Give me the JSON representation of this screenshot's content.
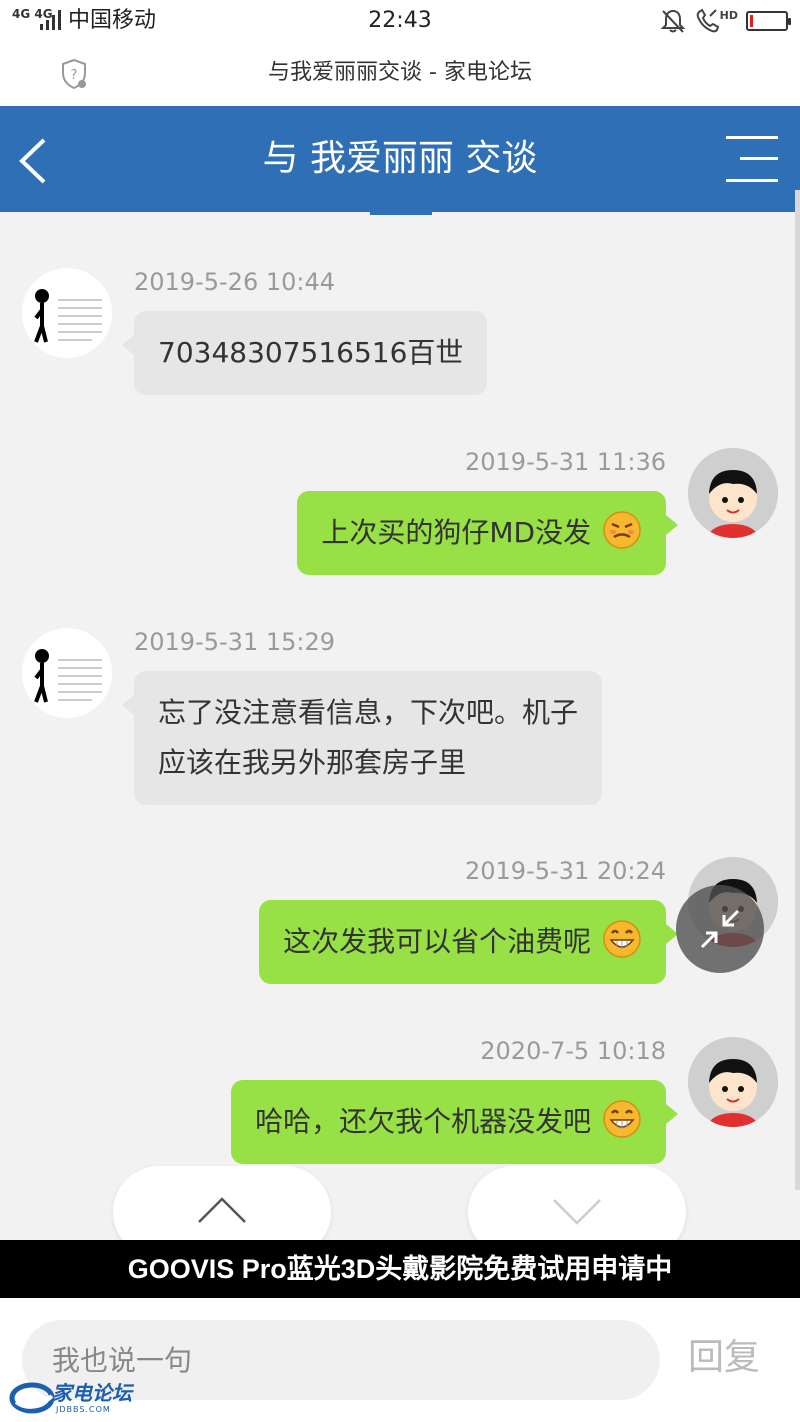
{
  "status_bar": {
    "network": "4G 4G",
    "carrier": "中国移动",
    "time": "22:43",
    "hd_label": "HD",
    "battery_level": 0.1,
    "battery_color": "#e02020",
    "icons": [
      "signal-icon",
      "mute-bell-icon",
      "hd-call-icon",
      "battery-icon"
    ]
  },
  "browser": {
    "title": "与我爱丽丽交谈 - 家电论坛",
    "icons": [
      "shield-question-icon"
    ]
  },
  "header": {
    "title": "与 我爱丽丽 交谈",
    "bg_color": "#2f6fb6",
    "icons": [
      "back-arrow-icon",
      "menu-icon"
    ]
  },
  "messages": [
    {
      "side": "left",
      "time": "2019-5-26 10:44",
      "lines": [
        "70348307516516百世"
      ],
      "emoji": ""
    },
    {
      "side": "right",
      "time": "2019-5-31 11:36",
      "lines": [
        "上次买的狗仔MD没发"
      ],
      "emoji": "annoyed-face-icon"
    },
    {
      "side": "left",
      "time": "2019-5-31 15:29",
      "lines": [
        "忘了没注意看信息，下次吧。机子",
        "应该在我另外那套房子里"
      ],
      "emoji": ""
    },
    {
      "side": "right",
      "time": "2019-5-31 20:24",
      "lines": [
        "这次发我可以省个油费呢"
      ],
      "emoji": "grin-face-icon"
    },
    {
      "side": "right",
      "time": "2020-7-5 10:18",
      "lines": [
        "哈哈，还欠我个机器没发吧"
      ],
      "emoji": "grin-face-icon"
    }
  ],
  "colors": {
    "bubble_left": "#e6e6e6",
    "bubble_right": "#97e045"
  },
  "banner": {
    "text": "GOOVIS Pro蓝光3D头戴影院免费试用申请中"
  },
  "reply": {
    "placeholder": "我也说一句",
    "button": "回复"
  },
  "watermark": {
    "name": "家电论坛",
    "url": "JDBBS.COM"
  }
}
